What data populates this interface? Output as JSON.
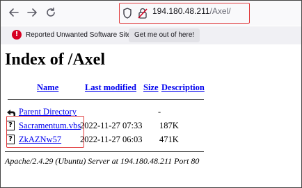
{
  "browser": {
    "url_host": "194.180.48.211",
    "url_path": "/Axel/",
    "icons": [
      "back-arrow-icon",
      "forward-arrow-icon",
      "reload-icon",
      "shield-icon",
      "insecure-lock-icon"
    ]
  },
  "warning_bar": {
    "message": "Reported Unwanted Software Site!",
    "button_label": "Get me out of here!",
    "icon": "warning-icon",
    "color": "#d70022"
  },
  "listing": {
    "title": "Index of /Axel",
    "headers": {
      "name": "Name",
      "last_modified": "Last modified",
      "size": "Size",
      "description": "Description"
    },
    "parent": {
      "label": "Parent Directory",
      "size": "-",
      "icon": "parent-directory-icon"
    },
    "rows": [
      {
        "name": "Sacramentum.vbs",
        "modified": "2022-11-27 07:33",
        "size": "187K",
        "icon": "unknown-file-icon"
      },
      {
        "name": "ZkAZNw57",
        "modified": "2022-11-27 06:03",
        "size": "471K",
        "icon": "unknown-file-icon"
      }
    ],
    "footer": "Apache/2.4.29 (Ubuntu) Server at 194.180.48.211 Port 80"
  },
  "annotation_color": "#e0393b"
}
